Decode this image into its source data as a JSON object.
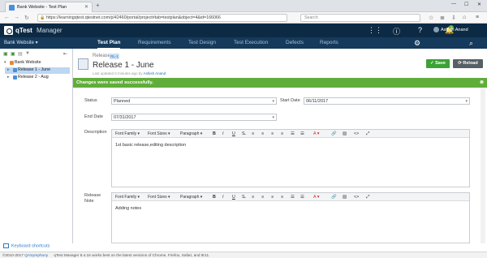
{
  "browser": {
    "tab_title": "Bank Website - Test Plan",
    "url": "https://learningqtest.qtestnet.com/p/42460/portal/project#tab=testplan&object=4&id=166066",
    "search_placeholder": "Search"
  },
  "app": {
    "brand_q": "qTest",
    "brand_manager": "Manager",
    "user_name": "Ashish Anand",
    "notification_count": "1"
  },
  "navbar": {
    "project": "Bank Website",
    "tabs": [
      "Test Plan",
      "Requirements",
      "Test Design",
      "Test Execution",
      "Defects",
      "Reports"
    ],
    "active_tab": "Test Plan"
  },
  "sidebar": {
    "items": [
      {
        "label": "Bank Website"
      },
      {
        "label": "Release 1 - June"
      },
      {
        "label": "Release 2 - Aug"
      }
    ],
    "keyboard_shortcuts": "Keyboard shortcuts"
  },
  "release": {
    "tag": "Release",
    "tag_id": "RL-1",
    "title": "Release 1 - June",
    "last_updated_prefix": "Last updated 0 minutes ago by",
    "last_updated_by": "Ashish Anand",
    "save_label": "Save",
    "reload_label": "Reload",
    "success_message": "Changes were saved successfully."
  },
  "form": {
    "status_label": "Status",
    "status_value": "Planned",
    "start_date_label": "Start Date",
    "start_date_value": "06/11/2017",
    "end_date_label": "End Date",
    "end_date_value": "07/31/2017",
    "description_label": "Description",
    "description_value": "1st basic release,editing description",
    "release_note_label_1": "Release",
    "release_note_label_2": "Note",
    "release_note_value": "Adding notes"
  },
  "editor_toolbar": {
    "font_family": "Font Family",
    "font_sizes": "Font Sizes",
    "paragraph": "Paragraph",
    "bold": "B",
    "italic": "I",
    "underline": "U"
  },
  "footer": {
    "copyright": "©2010-2017",
    "company": "QASymphony",
    "note": "qTest Manager 8.4.16 works best on the latest versions of Chrome, Firefox, Safari, and IE11."
  },
  "colors": {
    "header": "#0d2a44",
    "navbar": "#153a5c",
    "success": "#61ad3a",
    "save": "#3aa334",
    "reload": "#575f66"
  }
}
